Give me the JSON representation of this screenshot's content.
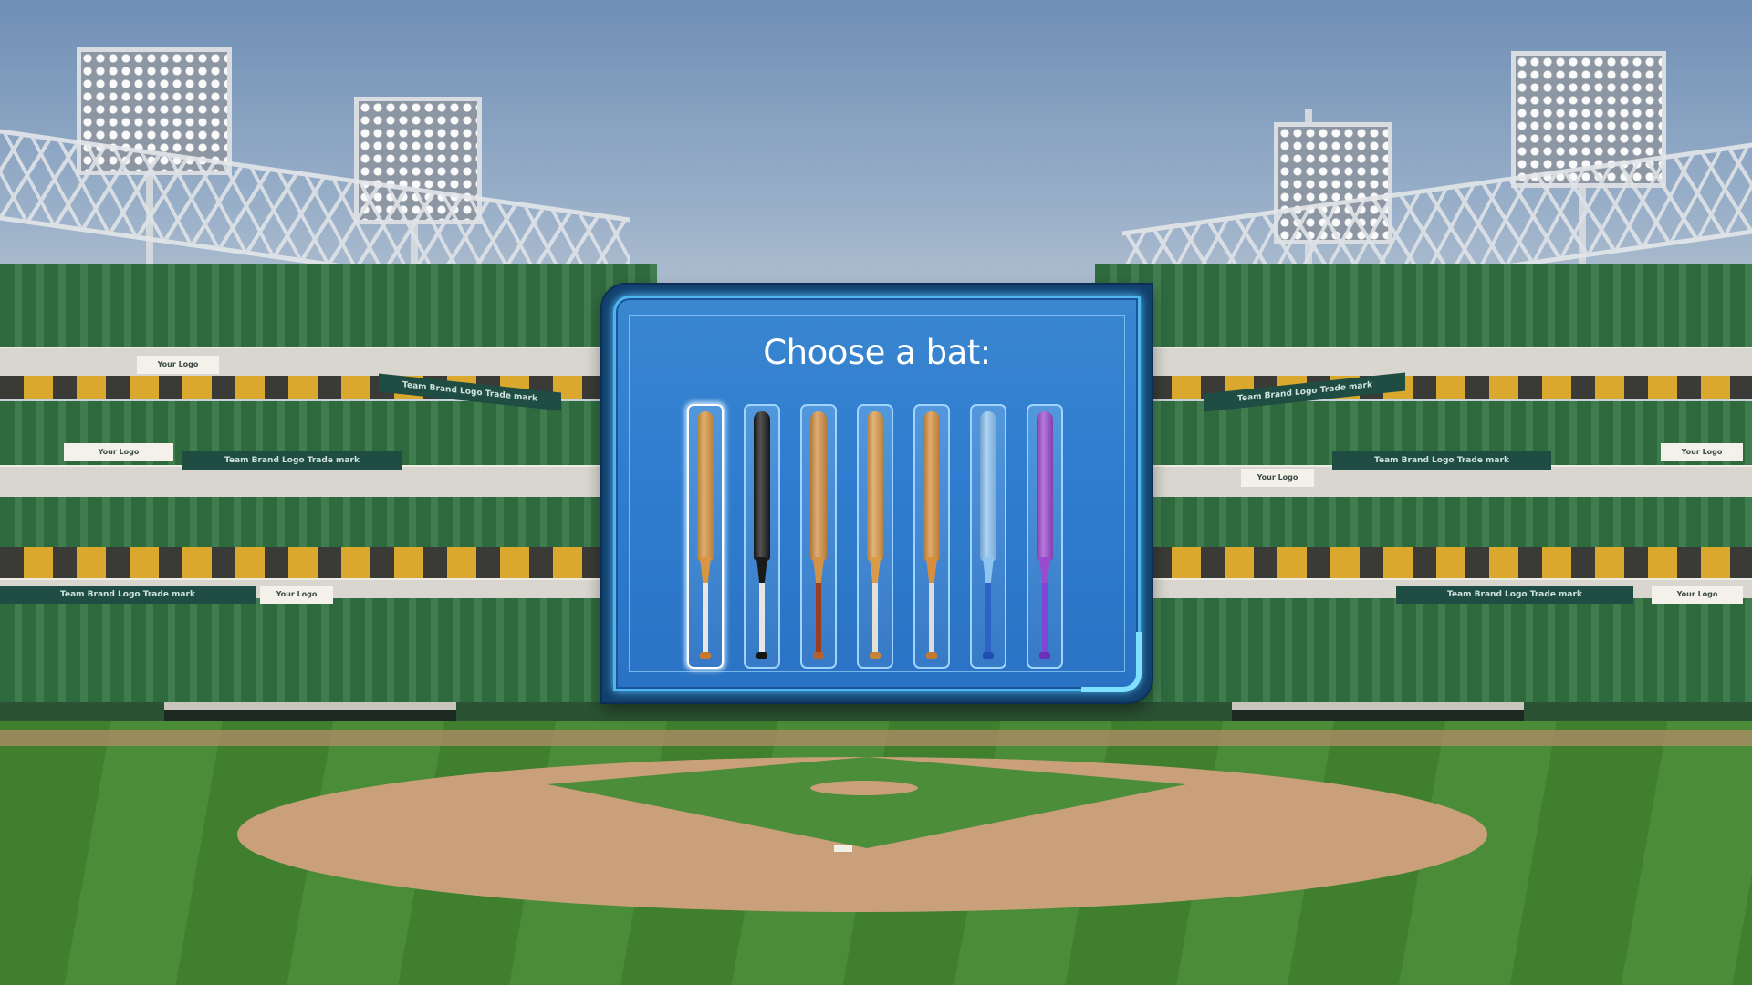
{
  "stadium": {
    "banner_texts": [
      "Team Brand Logo Trade mark",
      "Your Logo"
    ]
  },
  "dialog": {
    "title": "Choose a bat:",
    "selected_index": 0
  },
  "bats": [
    {
      "name": "bat-natural",
      "barrel": "#d9953f",
      "handle": "#e6e6e6",
      "knob": "#c77a2c"
    },
    {
      "name": "bat-black",
      "barrel": "#1a1a1a",
      "handle": "#e6e6e6",
      "knob": "#141414"
    },
    {
      "name": "bat-cherry",
      "barrel": "#d49246",
      "handle": "#9b3d1e",
      "knob": "#b46031"
    },
    {
      "name": "bat-maple",
      "barrel": "#d99b4a",
      "handle": "#e3e0d8",
      "knob": "#c8833a"
    },
    {
      "name": "bat-ash",
      "barrel": "#d78f3d",
      "handle": "#dcdcdc",
      "knob": "#c27a30"
    },
    {
      "name": "bat-blue",
      "barrel": "#8ec4f2",
      "handle": "#2f62c7",
      "knob": "#1e4fb0"
    },
    {
      "name": "bat-purple",
      "barrel": "#9a4bcf",
      "handle": "#8046d6",
      "knob": "#6b2fb8"
    }
  ]
}
